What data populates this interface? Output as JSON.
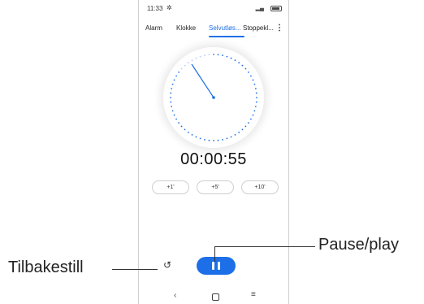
{
  "status_bar": {
    "time": "11:33",
    "settings_icon": "gear-icon",
    "signal_icon": "signal-icon",
    "battery_icon": "battery-icon"
  },
  "tabs": [
    {
      "label": "Alarm",
      "active": false
    },
    {
      "label": "Klokke",
      "active": false
    },
    {
      "label": "Selvutløs...",
      "active": true
    },
    {
      "label": "Stoppekl...",
      "active": false
    }
  ],
  "menu_icon": "more-vert-icon",
  "timer": {
    "display": "00:00:55"
  },
  "quick_add_buttons": [
    {
      "label": "+1'"
    },
    {
      "label": "+5'"
    },
    {
      "label": "+10'"
    }
  ],
  "controls": {
    "reset_icon": "reset-icon",
    "play_pause_icon": "pause-icon"
  },
  "navigation": {
    "back_icon": "back-icon",
    "home_icon": "home-icon",
    "recents_icon": "recents-icon"
  },
  "callouts": {
    "reset_label": "Tilbakestill",
    "pause_play_label": "Pause/play"
  },
  "colors": {
    "accent": "#1d6fe8"
  }
}
